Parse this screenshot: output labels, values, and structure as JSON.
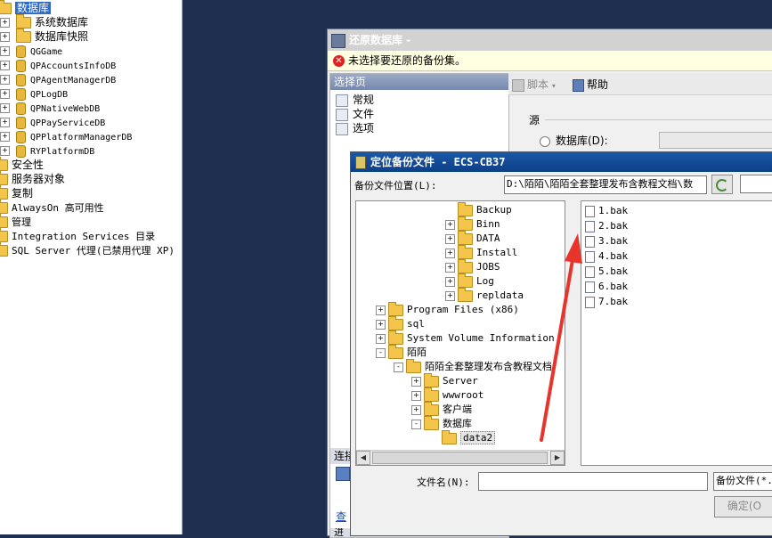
{
  "explorer": {
    "root": "数据库",
    "databases": [
      {
        "label": "系统数据库",
        "kind": "folder",
        "cjk": true
      },
      {
        "label": "数据库快照",
        "kind": "folder",
        "cjk": true
      },
      {
        "label": "QGGame",
        "kind": "db",
        "cjk": false
      },
      {
        "label": "QPAccountsInfoDB",
        "kind": "db",
        "cjk": false
      },
      {
        "label": "QPAgentManagerDB",
        "kind": "db",
        "cjk": false
      },
      {
        "label": "QPLogDB",
        "kind": "db",
        "cjk": false
      },
      {
        "label": "QPNativeWebDB",
        "kind": "db",
        "cjk": false
      },
      {
        "label": "QPPayServiceDB",
        "kind": "db",
        "cjk": false
      },
      {
        "label": "QPPlatformManagerDB",
        "kind": "db",
        "cjk": false
      },
      {
        "label": "RYPlatformDB",
        "kind": "db",
        "cjk": false
      }
    ],
    "top_nodes": [
      {
        "label": "安全性"
      },
      {
        "label": "服务器对象"
      },
      {
        "label": "复制"
      },
      {
        "label": "AlwaysOn 高可用性"
      },
      {
        "label": "管理"
      },
      {
        "label": "Integration Services 目录"
      },
      {
        "label": "SQL Server 代理(已禁用代理 XP)"
      }
    ]
  },
  "restore_window": {
    "title": "还原数据库 -",
    "message": "未选择要还原的备份集。",
    "pages_header": "选择页",
    "pages": [
      "常规",
      "文件",
      "选项"
    ],
    "toolbar_script": "脚本",
    "toolbar_help": "帮助",
    "source_label": "源",
    "database_radio": "数据库(D):",
    "connection_label": "连接",
    "view_link": "查",
    "progress_label": "进"
  },
  "locate_dialog": {
    "title": "定位备份文件 - ECS-CB37",
    "location_label": "备份文件位置(L):",
    "location_value": "D:\\陌陌\\陌陌全套整理发布含教程文档\\数",
    "folders": [
      {
        "label": "Backup",
        "level": 4,
        "expander": "",
        "selected": false
      },
      {
        "label": "Binn",
        "level": 4,
        "expander": "+",
        "selected": false
      },
      {
        "label": "DATA",
        "level": 4,
        "expander": "+",
        "selected": false
      },
      {
        "label": "Install",
        "level": 4,
        "expander": "+",
        "selected": false
      },
      {
        "label": "JOBS",
        "level": 4,
        "expander": "+",
        "selected": false
      },
      {
        "label": "Log",
        "level": 4,
        "expander": "+",
        "selected": false
      },
      {
        "label": "repldata",
        "level": 4,
        "expander": "+",
        "selected": false
      },
      {
        "label": "Program Files (x86)",
        "level": 0,
        "expander": "+",
        "selected": false
      },
      {
        "label": "sql",
        "level": 0,
        "expander": "+",
        "selected": false
      },
      {
        "label": "System Volume Information",
        "level": 0,
        "expander": "+",
        "selected": false
      },
      {
        "label": "陌陌",
        "level": 0,
        "expander": "-",
        "selected": false
      },
      {
        "label": "陌陌全套整理发布含教程文档",
        "level": 1,
        "expander": "-",
        "selected": false
      },
      {
        "label": "Server",
        "level": 2,
        "expander": "+",
        "selected": false
      },
      {
        "label": "wwwroot",
        "level": 2,
        "expander": "+",
        "selected": false
      },
      {
        "label": "客户端",
        "level": 2,
        "expander": "+",
        "selected": false
      },
      {
        "label": "数据库",
        "level": 2,
        "expander": "-",
        "selected": false
      },
      {
        "label": "data2",
        "level": 3,
        "expander": "",
        "selected": true
      }
    ],
    "files": [
      "1.bak",
      "2.bak",
      "3.bak",
      "4.bak",
      "5.bak",
      "6.bak",
      "7.bak"
    ],
    "filename_label": "文件名(N):",
    "filename_value": "",
    "filetype_value": "备份文件(*.",
    "ok_button": "确定(O"
  },
  "colors": {
    "desktop": "#1f2f4f",
    "dialog_title": "#0d3f86",
    "selection": "#316ac5",
    "arrow": "#e8352b"
  }
}
